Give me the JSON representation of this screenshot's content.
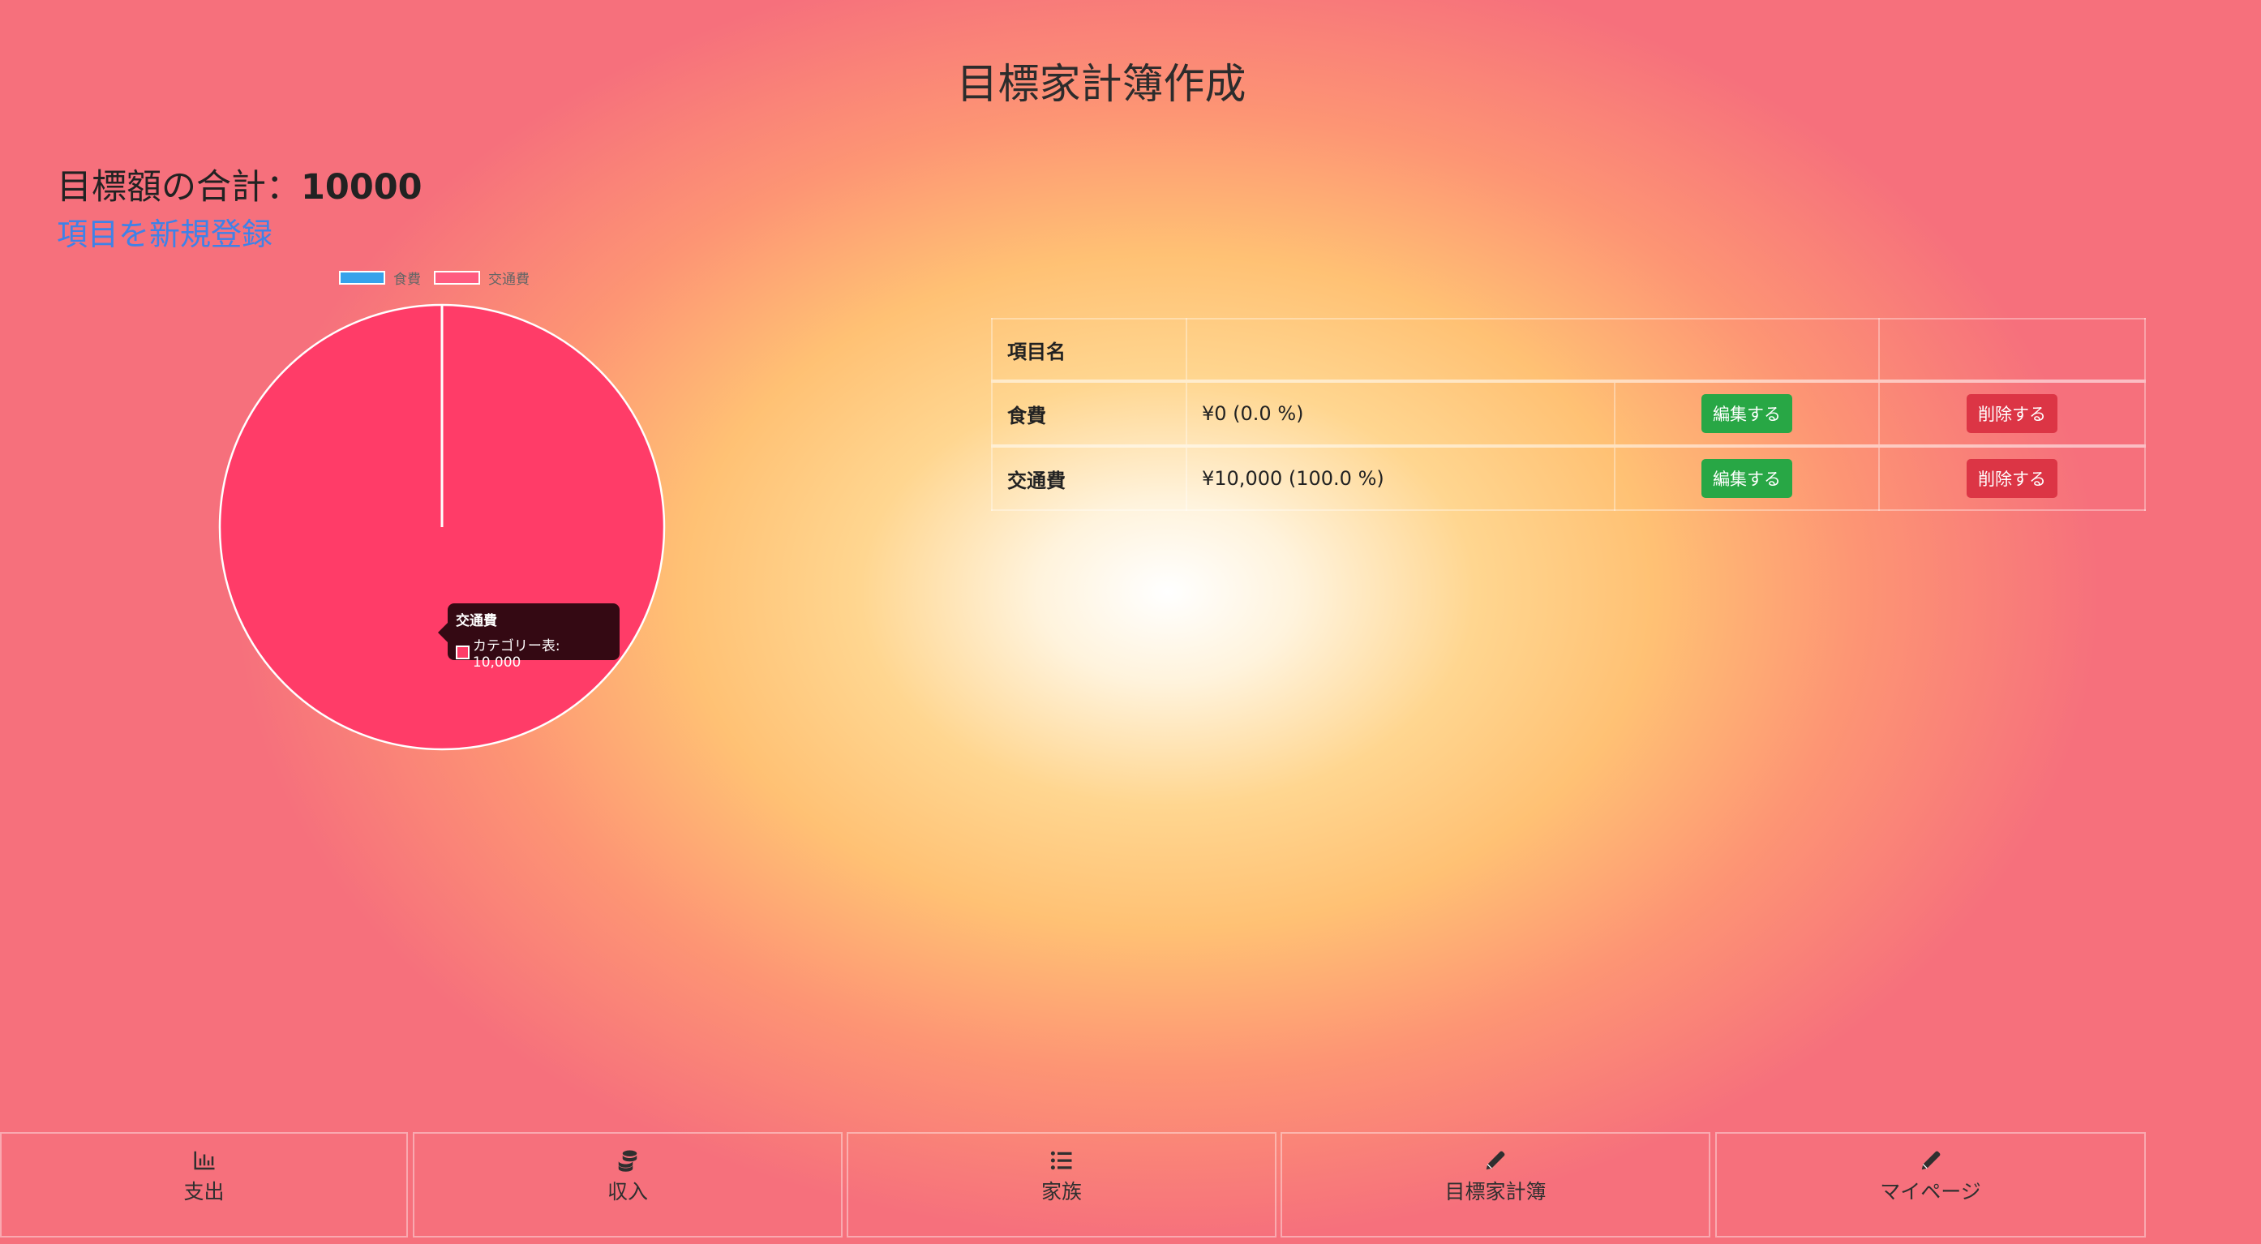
{
  "title": "目標家計簿作成",
  "summary": {
    "label": "目標額の合計：",
    "amount": "10000"
  },
  "new_item_link": "項目を新規登録",
  "colors": {
    "food": "#36a2eb",
    "transport": "#ff3c68",
    "edit": "#28a745",
    "delete": "#dc3545",
    "link": "#3e82e8"
  },
  "chart_data": {
    "type": "pie",
    "series_label": "カテゴリー表",
    "legend": [
      "食費",
      "交通費"
    ],
    "slices": [
      {
        "label": "食費",
        "value": 0
      },
      {
        "label": "交通費",
        "value": 10000
      }
    ],
    "legend_position": "top",
    "tooltip": {
      "title": "交通費",
      "line": "カテゴリー表: 10,000"
    }
  },
  "table": {
    "header": "項目名",
    "rows": [
      {
        "name": "食費",
        "amount": "¥0 (0.0 %)",
        "edit": "編集する",
        "delete": "削除する"
      },
      {
        "name": "交通費",
        "amount": "¥10,000 (100.0 %)",
        "edit": "編集する",
        "delete": "削除する"
      }
    ]
  },
  "nav": [
    {
      "label": "支出",
      "icon": "bar-chart-icon"
    },
    {
      "label": "収入",
      "icon": "coins-icon"
    },
    {
      "label": "家族",
      "icon": "list-icon"
    },
    {
      "label": "目標家計簿",
      "icon": "pencil-icon"
    },
    {
      "label": "マイページ",
      "icon": "pencil-icon"
    }
  ]
}
